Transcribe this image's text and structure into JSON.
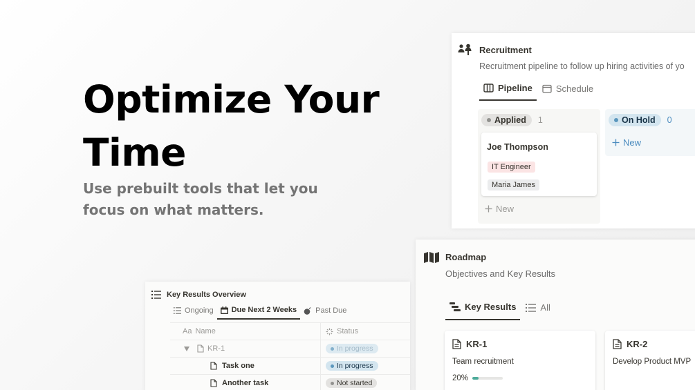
{
  "hero": {
    "title": "Optimize Your Time",
    "subtitle": "Use prebuilt tools that let you focus on what matters."
  },
  "colors": {
    "blue_pill_bg": "#d3e5ef",
    "gray_pill_bg": "#e3e2e0",
    "tag_pink_bg": "#fbe4e4",
    "tag_gray_bg": "#ebeced",
    "progress_green": "#4dab9a"
  },
  "recruitment": {
    "icon": "people-icon",
    "title": "Recruitment",
    "description": "Recruitment pipeline to follow up hiring activities of yo",
    "tabs": [
      {
        "label": "Pipeline",
        "icon": "board-icon",
        "active": true
      },
      {
        "label": "Schedule",
        "icon": "calendar-icon",
        "active": false
      }
    ],
    "columns": [
      {
        "status": "Applied",
        "count": "1",
        "cards": [
          {
            "name": "Joe Thompson",
            "tags": [
              "IT Engineer",
              "Maria James"
            ]
          }
        ],
        "new_label": "New"
      },
      {
        "status": "On Hold",
        "count": "0",
        "new_label": "New"
      }
    ]
  },
  "roadmap": {
    "icon": "map-icon",
    "title": "Roadmap",
    "description": "Objectives and Key Results",
    "tabs": [
      {
        "label": "Key Results",
        "icon": "timeline-icon",
        "active": true
      },
      {
        "label": "All",
        "icon": "list-icon",
        "active": false
      }
    ],
    "cards": [
      {
        "title": "KR-1",
        "subtitle": "Team recruitment",
        "progress_label": "20%",
        "progress": 0.2
      },
      {
        "title": "KR-2",
        "subtitle": "Develop Product MVP"
      }
    ]
  },
  "key_results": {
    "icon": "list-icon",
    "title": "Key Results Overview",
    "tabs": [
      {
        "label": "Ongoing",
        "icon": "list-icon",
        "active": false
      },
      {
        "label": "Due Next 2 Weeks",
        "icon": "calendar-icon",
        "active": true
      },
      {
        "label": "Past Due",
        "icon": "bomb-icon",
        "active": false
      }
    ],
    "columns": {
      "name_prefix": "Aa",
      "name": "Name",
      "status": "Status"
    },
    "rows": [
      {
        "name": "KR-1",
        "status": "In progress",
        "level": 0
      },
      {
        "name": "Task one",
        "status": "In progress",
        "level": 1
      },
      {
        "name": "Another task",
        "status": "Not started",
        "level": 1
      }
    ]
  }
}
